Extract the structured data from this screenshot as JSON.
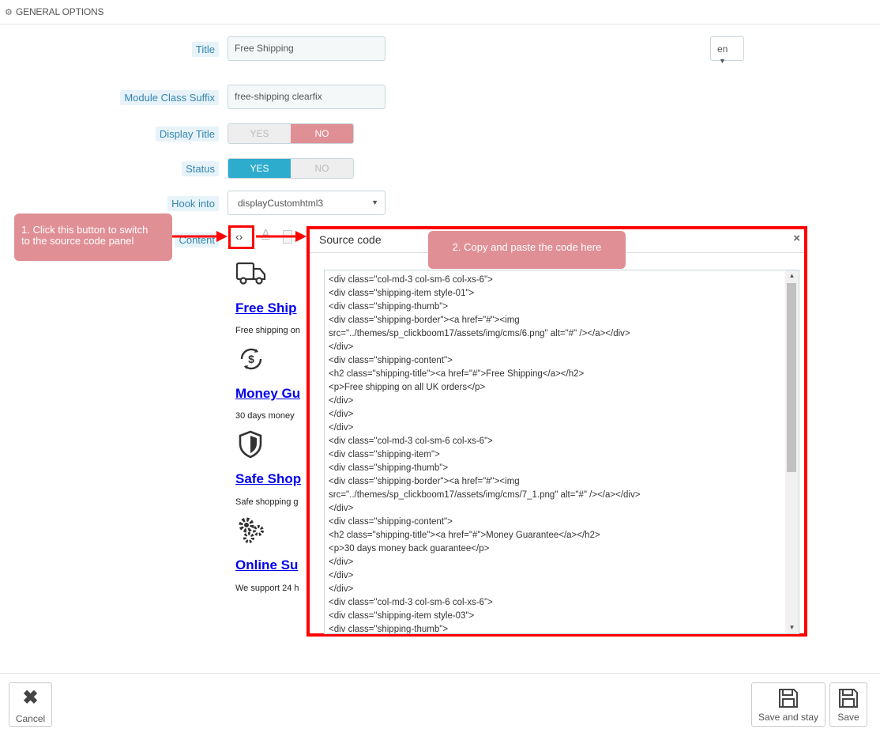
{
  "section": {
    "title": "GENERAL OPTIONS",
    "icon": "gears-icon"
  },
  "form": {
    "title_label": "Title",
    "title_value": "Free Shipping",
    "language": "en",
    "suffix_label": "Module Class Suffix",
    "suffix_value": "free-shipping clearfix",
    "display_title_label": "Display Title",
    "display_title": {
      "yes": "YES",
      "no": "NO",
      "selected": "NO"
    },
    "status_label": "Status",
    "status": {
      "yes": "YES",
      "no": "NO",
      "selected": "YES"
    },
    "hook_label": "Hook into",
    "hook_value": "displayCustomhtml3",
    "content_label": "Content"
  },
  "editor_toolbar": {
    "source_icon": "code-icon",
    "text_color_icon": "font-color-icon"
  },
  "preview": [
    {
      "icon": "truck-icon",
      "title": "Free Ship",
      "text": "Free shipping on"
    },
    {
      "icon": "money-cycle-icon",
      "title": "Money Gu",
      "text": "30 days money"
    },
    {
      "icon": "shield-icon",
      "title": "Safe Shop",
      "text": "Safe shopping g"
    },
    {
      "icon": "gears-icon",
      "title": "Online Su",
      "text": "We support 24 h"
    }
  ],
  "callouts": {
    "step1_line1": "1. Click this button to switch",
    "step1_line2": "to the source code panel",
    "step2": "2. Copy and paste the code here"
  },
  "colors": {
    "callout": "#e08f95",
    "highlight": "#ff0000",
    "accent": "#2eacce",
    "no": "#e08f95"
  },
  "source_dialog": {
    "title": "Source code",
    "close": "×",
    "lines": [
      "<div class=\"col-md-3 col-sm-6 col-xs-6\">",
      "<div class=\"shipping-item style-01\">",
      "<div class=\"shipping-thumb\">",
      "<div class=\"shipping-border\"><a href=\"#\"><img",
      "src=\"../themes/sp_clickboom17/assets/img/cms/6.png\" alt=\"#\" /></a></div>",
      "</div>",
      "<div class=\"shipping-content\">",
      "<h2 class=\"shipping-title\"><a href=\"#\">Free Shipping</a></h2>",
      "<p>Free shipping on all UK orders</p>",
      "</div>",
      "</div>",
      "</div>",
      "<div class=\"col-md-3 col-sm-6 col-xs-6\">",
      "<div class=\"shipping-item\">",
      "<div class=\"shipping-thumb\">",
      "<div class=\"shipping-border\"><a href=\"#\"><img",
      "src=\"../themes/sp_clickboom17/assets/img/cms/7_1.png\" alt=\"#\" /></a></div>",
      "</div>",
      "<div class=\"shipping-content\">",
      "<h2 class=\"shipping-title\"><a href=\"#\">Money Guarantee</a></h2>",
      "<p>30 days money back guarantee</p>",
      "</div>",
      "</div>",
      "</div>",
      "<div class=\"col-md-3 col-sm-6 col-xs-6\">",
      "<div class=\"shipping-item style-03\">",
      "<div class=\"shipping-thumb\">"
    ]
  },
  "footer": {
    "cancel_label": "Cancel",
    "save_stay_label": "Save and stay",
    "save_label": "Save"
  }
}
